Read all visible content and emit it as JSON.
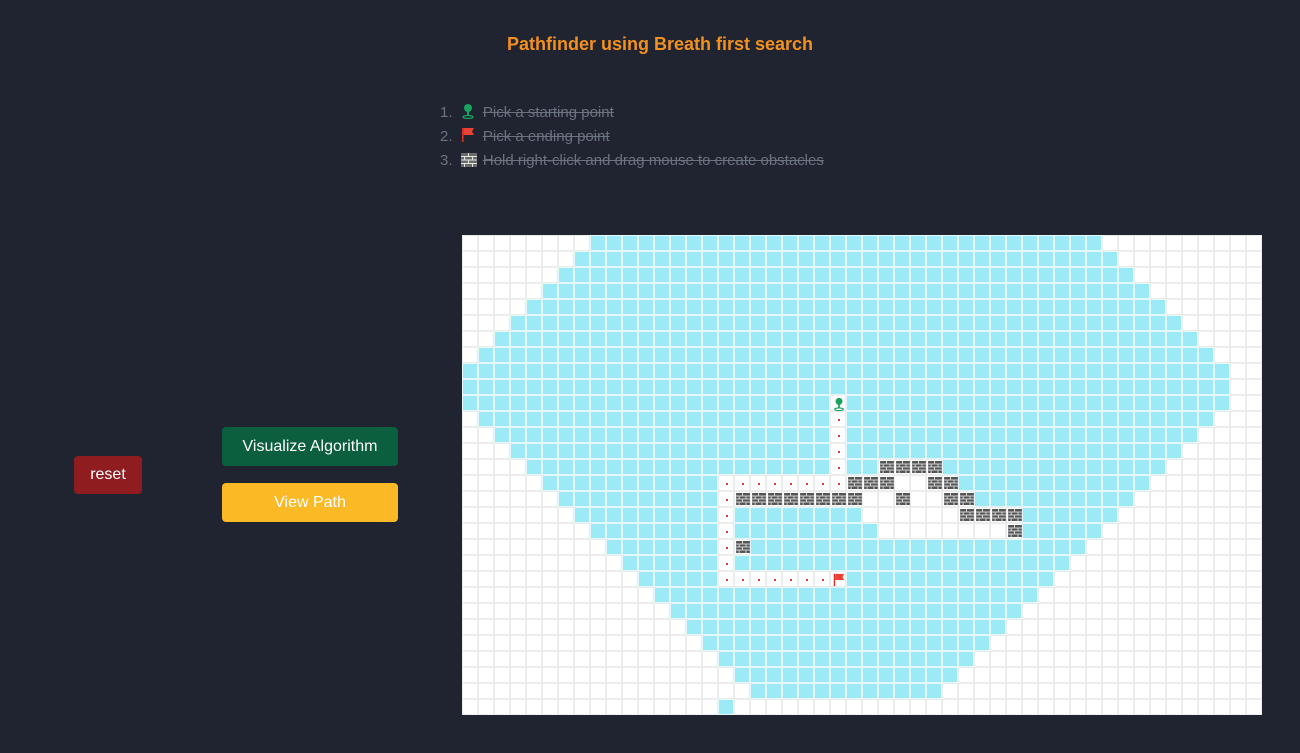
{
  "header": {
    "title": "Pathfinder using Breath first search"
  },
  "instructions": [
    {
      "number": "1.",
      "icon": "start-pin-icon",
      "text": "Pick a starting point"
    },
    {
      "number": "2.",
      "icon": "red-flag-icon",
      "text": "Pick a ending point"
    },
    {
      "number": "3.",
      "icon": "brick-wall-icon",
      "text": "Hold right-click and drag mouse to create obstacles"
    }
  ],
  "buttons": {
    "reset": "reset",
    "visualize": "Visualize Algorithm",
    "view_path": "View Path"
  },
  "colors": {
    "background": "#1f2430",
    "title": "#f4901e",
    "visited": "#9ceaf6",
    "path_dot": "#e3342f",
    "reset": "#8f1c1f",
    "visualize": "#0b5e3e",
    "view_path": "#fbba25"
  },
  "grid": {
    "rows": 30,
    "cols": 50,
    "start": [
      10,
      23
    ],
    "end": [
      21,
      23
    ],
    "walls": [
      [
        14,
        26
      ],
      [
        14,
        27
      ],
      [
        14,
        28
      ],
      [
        14,
        29
      ],
      [
        15,
        24
      ],
      [
        15,
        25
      ],
      [
        15,
        26
      ],
      [
        15,
        29
      ],
      [
        15,
        30
      ],
      [
        16,
        17
      ],
      [
        16,
        18
      ],
      [
        16,
        19
      ],
      [
        16,
        20
      ],
      [
        16,
        21
      ],
      [
        16,
        22
      ],
      [
        16,
        23
      ],
      [
        16,
        24
      ],
      [
        16,
        27
      ],
      [
        16,
        30
      ],
      [
        16,
        31
      ],
      [
        17,
        31
      ],
      [
        17,
        32
      ],
      [
        17,
        33
      ],
      [
        17,
        34
      ],
      [
        18,
        34
      ],
      [
        19,
        17
      ]
    ],
    "path": [
      [
        11,
        23
      ],
      [
        12,
        23
      ],
      [
        13,
        23
      ],
      [
        14,
        23
      ],
      [
        15,
        23
      ],
      [
        15,
        22
      ],
      [
        15,
        21
      ],
      [
        15,
        20
      ],
      [
        15,
        19
      ],
      [
        15,
        18
      ],
      [
        15,
        17
      ],
      [
        15,
        16
      ],
      [
        16,
        16
      ],
      [
        17,
        16
      ],
      [
        18,
        16
      ],
      [
        19,
        16
      ],
      [
        20,
        16
      ],
      [
        21,
        16
      ],
      [
        21,
        17
      ],
      [
        21,
        18
      ],
      [
        21,
        19
      ],
      [
        21,
        20
      ],
      [
        21,
        21
      ],
      [
        21,
        22
      ]
    ],
    "unvisited_open": [
      [
        15,
        27
      ],
      [
        15,
        28
      ],
      [
        16,
        25
      ],
      [
        16,
        26
      ],
      [
        16,
        28
      ],
      [
        16,
        29
      ],
      [
        17,
        25
      ],
      [
        17,
        26
      ],
      [
        17,
        27
      ],
      [
        17,
        28
      ],
      [
        17,
        29
      ],
      [
        17,
        30
      ],
      [
        18,
        26
      ],
      [
        18,
        27
      ],
      [
        18,
        28
      ],
      [
        18,
        29
      ],
      [
        18,
        30
      ],
      [
        18,
        31
      ],
      [
        18,
        32
      ],
      [
        18,
        33
      ]
    ],
    "visited_rows": [
      [
        8,
        39
      ],
      [
        7,
        40
      ],
      [
        6,
        41
      ],
      [
        5,
        42
      ],
      [
        4,
        43
      ],
      [
        3,
        44
      ],
      [
        2,
        45
      ],
      [
        1,
        46
      ],
      [
        0,
        47
      ],
      [
        0,
        47
      ],
      [
        0,
        47
      ],
      [
        1,
        46
      ],
      [
        2,
        45
      ],
      [
        3,
        44
      ],
      [
        4,
        43
      ],
      [
        5,
        42
      ],
      [
        6,
        41
      ],
      [
        7,
        40
      ],
      [
        8,
        39
      ],
      [
        9,
        38
      ],
      [
        10,
        37
      ],
      [
        11,
        36
      ],
      [
        12,
        35
      ],
      [
        13,
        34
      ],
      [
        14,
        33
      ],
      [
        15,
        32
      ],
      [
        16,
        31
      ],
      [
        17,
        30
      ],
      [
        18,
        29
      ],
      [
        16,
        16
      ]
    ],
    "visited_right_limit": [
      39,
      40,
      41,
      42,
      43,
      44,
      45,
      46,
      47,
      47,
      47,
      46,
      45,
      44,
      43,
      42,
      41,
      40,
      39,
      38,
      37,
      36,
      35,
      34,
      33,
      32,
      31,
      30,
      29,
      16
    ]
  }
}
